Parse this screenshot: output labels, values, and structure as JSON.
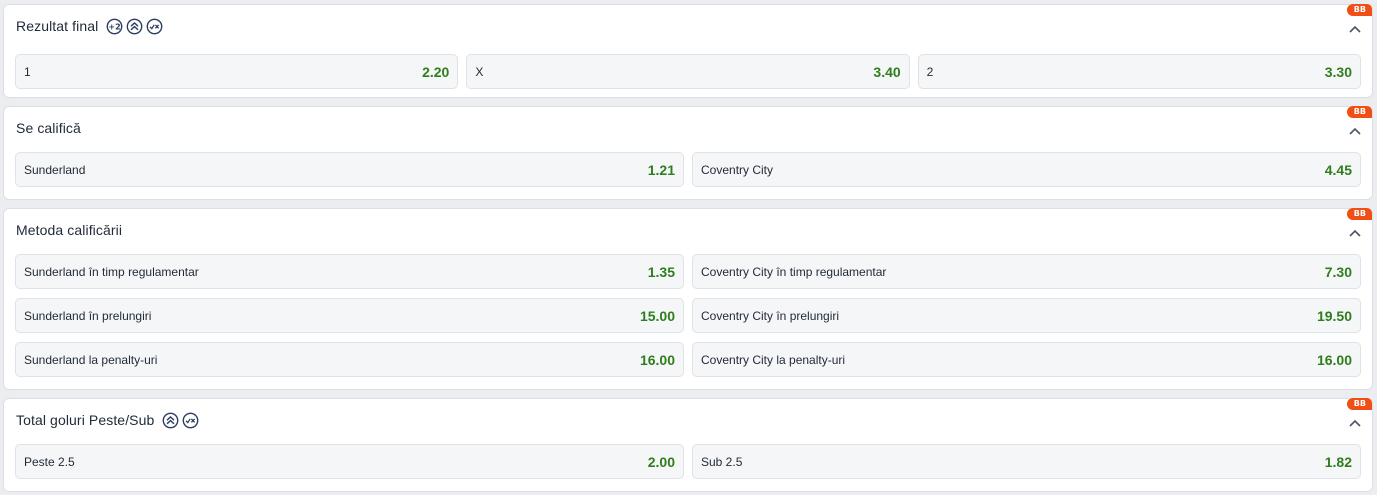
{
  "colors": {
    "odd_value": "#2f7d1e",
    "badge": "#f04e14",
    "icon": "#2c3e60"
  },
  "markets": [
    {
      "title": "Rezultat final",
      "badge": "BB",
      "icons": [
        "plus-two-goals-icon",
        "double-chevron-up-icon",
        "check-cross-icon"
      ],
      "rows": [
        [
          {
            "label": "1",
            "odd": "2.20"
          },
          {
            "label": "X",
            "odd": "3.40"
          },
          {
            "label": "2",
            "odd": "3.30"
          }
        ]
      ]
    },
    {
      "title": "Se califică",
      "badge": "BB",
      "icons": [],
      "rows": [
        [
          {
            "label": "Sunderland",
            "odd": "1.21"
          },
          {
            "label": "Coventry City",
            "odd": "4.45"
          }
        ]
      ]
    },
    {
      "title": "Metoda calificării",
      "badge": "BB",
      "icons": [],
      "rows": [
        [
          {
            "label": "Sunderland în timp regulamentar",
            "odd": "1.35"
          },
          {
            "label": "Coventry City în timp regulamentar",
            "odd": "7.30"
          }
        ],
        [
          {
            "label": "Sunderland în prelungiri",
            "odd": "15.00"
          },
          {
            "label": "Coventry City în prelungiri",
            "odd": "19.50"
          }
        ],
        [
          {
            "label": "Sunderland la penalty-uri",
            "odd": "16.00"
          },
          {
            "label": "Coventry City la penalty-uri",
            "odd": "16.00"
          }
        ]
      ]
    },
    {
      "title": "Total goluri Peste/Sub",
      "badge": "BB",
      "icons": [
        "double-chevron-up-icon",
        "check-cross-icon"
      ],
      "rows": [
        [
          {
            "label": "Peste 2.5",
            "odd": "2.00"
          },
          {
            "label": "Sub 2.5",
            "odd": "1.82"
          }
        ]
      ]
    }
  ]
}
